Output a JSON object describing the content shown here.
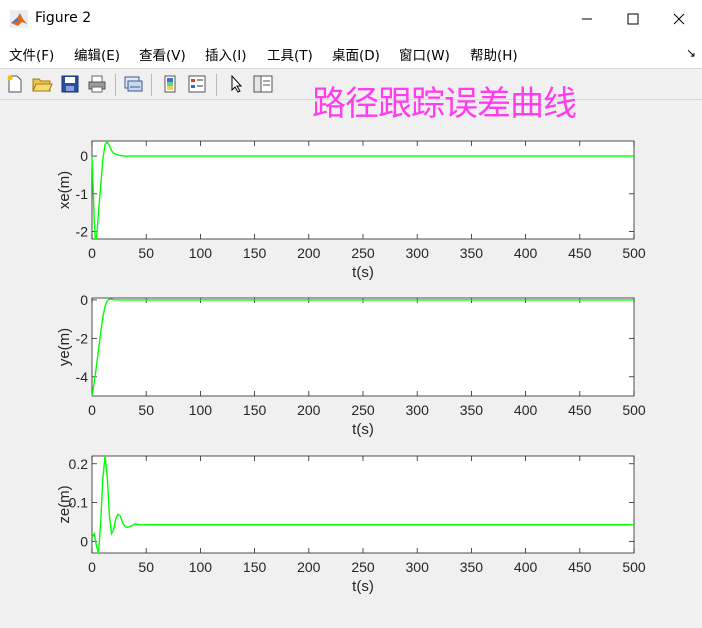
{
  "window": {
    "title": "Figure 2"
  },
  "menu": {
    "items": [
      "文件(F)",
      "编辑(E)",
      "查看(V)",
      "插入(I)",
      "工具(T)",
      "桌面(D)",
      "窗口(W)",
      "帮助(H)"
    ]
  },
  "annotation_text": "路径跟踪误差曲线",
  "colors": {
    "line": "#00ff00",
    "annotation": "#ff3cf0"
  },
  "toolbar_icons": [
    "new-file-icon",
    "open-folder-icon",
    "save-icon",
    "print-icon",
    "link-plot-icon",
    "colorbar-icon",
    "legend-icon",
    "pointer-icon",
    "property-inspector-icon"
  ],
  "chart_data": [
    {
      "type": "line",
      "xlabel": "t(s)",
      "ylabel": "xe(m)",
      "xlim": [
        0,
        500
      ],
      "ylim": [
        -2.2,
        0.4
      ],
      "xticks": [
        0,
        50,
        100,
        150,
        200,
        250,
        300,
        350,
        400,
        450,
        500
      ],
      "yticks": [
        0,
        -1,
        -2
      ],
      "ytick_labels": [
        "0",
        "-1",
        "-2"
      ],
      "series": [
        {
          "color": "#00ff00",
          "x": [
            0,
            1,
            2,
            3,
            4,
            5,
            6,
            8,
            10,
            12,
            14,
            16,
            18,
            20,
            25,
            30,
            40,
            60,
            100,
            200,
            300,
            400,
            500
          ],
          "y": [
            0,
            -0.8,
            -1.7,
            -2.2,
            -2.2,
            -1.9,
            -1.5,
            -0.8,
            -0.1,
            0.3,
            0.38,
            0.28,
            0.15,
            0.07,
            0.02,
            0.0,
            0.0,
            0.0,
            0.0,
            0.0,
            0.0,
            0.0,
            0.0
          ]
        }
      ]
    },
    {
      "type": "line",
      "xlabel": "t(s)",
      "ylabel": "ye(m)",
      "xlim": [
        0,
        500
      ],
      "ylim": [
        -5,
        0.1
      ],
      "xticks": [
        0,
        50,
        100,
        150,
        200,
        250,
        300,
        350,
        400,
        450,
        500
      ],
      "yticks": [
        0,
        -2,
        -4
      ],
      "ytick_labels": [
        "0",
        "-2",
        "-4"
      ],
      "series": [
        {
          "color": "#00ff00",
          "x": [
            0,
            2,
            4,
            6,
            8,
            10,
            12,
            14,
            16,
            18,
            20,
            25,
            30,
            40,
            60,
            100,
            200,
            300,
            400,
            500
          ],
          "y": [
            -5.0,
            -4.3,
            -3.5,
            -2.6,
            -1.7,
            -0.9,
            -0.35,
            -0.05,
            0.05,
            0.04,
            0.01,
            0.0,
            0.0,
            0.0,
            0.0,
            0.0,
            0.0,
            0.0,
            0.0,
            0.0
          ]
        }
      ]
    },
    {
      "type": "line",
      "xlabel": "t(s)",
      "ylabel": "ze(m)",
      "xlim": [
        0,
        500
      ],
      "ylim": [
        -0.03,
        0.22
      ],
      "xticks": [
        0,
        50,
        100,
        150,
        200,
        250,
        300,
        350,
        400,
        450,
        500
      ],
      "yticks": [
        0.2,
        0.1,
        0
      ],
      "ytick_labels": [
        "0.2",
        "0.1",
        "0"
      ],
      "series": [
        {
          "color": "#00ff00",
          "x": [
            0,
            2,
            4,
            6,
            8,
            10,
            12,
            14,
            16,
            18,
            20,
            22,
            24,
            26,
            28,
            30,
            32,
            35,
            40,
            45,
            50,
            60,
            100,
            200,
            300,
            400,
            500
          ],
          "y": [
            0.01,
            0.02,
            -0.01,
            -0.03,
            0.05,
            0.16,
            0.22,
            0.17,
            0.07,
            0.02,
            0.03,
            0.06,
            0.07,
            0.065,
            0.05,
            0.04,
            0.036,
            0.038,
            0.045,
            0.042,
            0.043,
            0.043,
            0.043,
            0.043,
            0.043,
            0.043,
            0.043
          ]
        }
      ]
    }
  ]
}
